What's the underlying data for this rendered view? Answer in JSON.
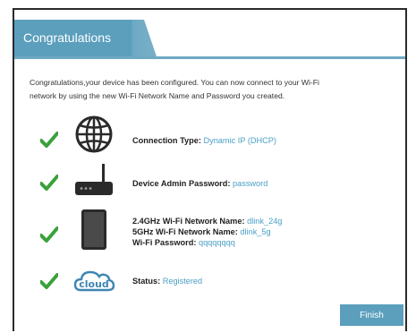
{
  "dialog": {
    "title": "Congratulations",
    "intro_line1": "Congratulations,your device has been configured. You can now connect to your Wi-Fi",
    "intro_line2": "network by using the new Wi-Fi Network Name and Password you created.",
    "finish_label": "Finish"
  },
  "items": {
    "connection": {
      "label": "Connection Type:",
      "value": "Dynamic IP (DHCP)",
      "icon": "globe-icon"
    },
    "admin": {
      "label": "Device Admin Password:",
      "value": "password",
      "icon": "router-icon"
    },
    "wifi": {
      "icon": "tablet-icon",
      "name24_label": "2.4GHz Wi-Fi Network Name:",
      "name24_value": "dlink_24g",
      "name5_label": "5GHz Wi-Fi Network Name:",
      "name5_value": "dlink_5g",
      "password_label": "Wi-Fi Password:",
      "password_value": "qqqqqqqq"
    },
    "cloud": {
      "label": "Status:",
      "value": "Registered",
      "icon": "cloud-icon",
      "icon_text": "cloud"
    }
  },
  "colors": {
    "accent": "#5b9fbd",
    "value": "#4aa0c6",
    "check": "#3aa13a"
  }
}
